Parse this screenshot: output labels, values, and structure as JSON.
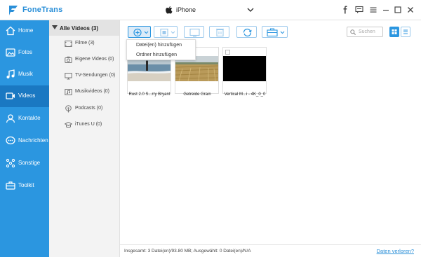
{
  "app": {
    "name": "FoneTrans",
    "device": "iPhone"
  },
  "sidebar": {
    "items": [
      {
        "label": "Home",
        "icon": "home-icon"
      },
      {
        "label": "Fotos",
        "icon": "photo-icon"
      },
      {
        "label": "Musik",
        "icon": "music-icon"
      },
      {
        "label": "Videos",
        "icon": "video-icon",
        "active": true
      },
      {
        "label": "Kontakte",
        "icon": "contacts-icon"
      },
      {
        "label": "Nachrichten",
        "icon": "messages-icon"
      },
      {
        "label": "Sonstige",
        "icon": "other-icon"
      },
      {
        "label": "Toolkit",
        "icon": "toolkit-icon"
      }
    ]
  },
  "categories": {
    "header": "Alle Videos (3)",
    "items": [
      {
        "label": "Filme (3)",
        "icon": "film-icon"
      },
      {
        "label": "Eigene Videos (0)",
        "icon": "camera-icon"
      },
      {
        "label": "TV-Sendungen (0)",
        "icon": "tv-icon"
      },
      {
        "label": "Musikvideos (0)",
        "icon": "music-video-icon"
      },
      {
        "label": "Podcasts (0)",
        "icon": "podcast-icon"
      },
      {
        "label": "iTunes U (0)",
        "icon": "itunes-u-icon"
      }
    ]
  },
  "toolbar": {
    "search_placeholder": "Suchen"
  },
  "add_menu": {
    "items": [
      "Datei(en) hinzufügen",
      "Ordner hinzufügen"
    ]
  },
  "videos": [
    {
      "name": "Rust 2.0 S...rry Bryant"
    },
    {
      "name": "Getreide   Grain"
    },
    {
      "name": "Vertical M...i - 4K_0_0"
    }
  ],
  "status": {
    "info": "Insgesamt: 3 Datei(en)/93.80 MB; Ausgewählt: 0 Datei(en)/N/A",
    "link": "Daten verloren?"
  },
  "colors": {
    "accent": "#2b96e0",
    "active": "#1a78c2",
    "link": "#2a8fd8"
  }
}
